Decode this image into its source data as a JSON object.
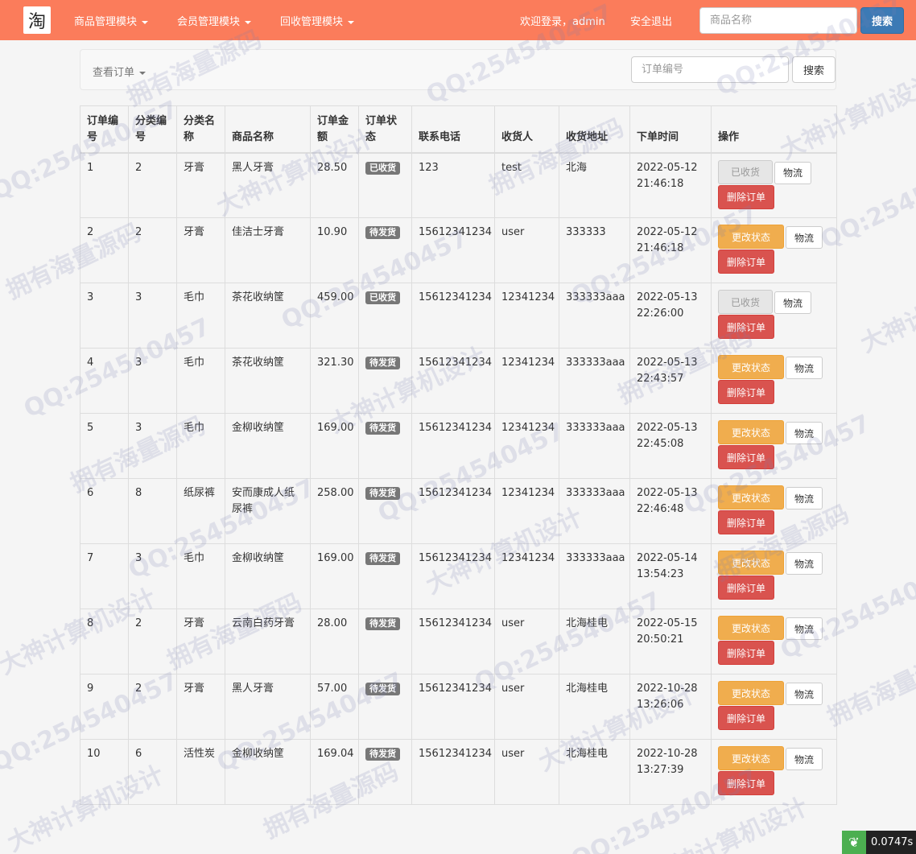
{
  "header": {
    "logo_char": "淘",
    "nav": [
      "商品管理模块",
      "会员管理模块",
      "回收管理模块"
    ],
    "welcome": "欢迎登录，admin",
    "logout": "安全退出",
    "search_placeholder": "商品名称",
    "search_button": "搜索"
  },
  "subnav": {
    "dropdown_label": "查看订单",
    "order_placeholder": "订单编号",
    "search_button": "搜索"
  },
  "table": {
    "columns": [
      "订单编号",
      "分类编号",
      "分类名称",
      "商品名称",
      "订单金额",
      "订单状态",
      "联系电话",
      "收货人",
      "收货地址",
      "下单时间",
      "操作"
    ],
    "rows": [
      {
        "id": "1",
        "cat_id": "2",
        "cat_name": "牙膏",
        "product": "黑人牙膏",
        "amount": "28.50",
        "status": "已收货",
        "phone": "123",
        "receiver": "test",
        "address": "北海",
        "date": "2022-05-12",
        "time": "21:46:18",
        "action": "已收货"
      },
      {
        "id": "2",
        "cat_id": "2",
        "cat_name": "牙膏",
        "product": "佳洁士牙膏",
        "amount": "10.90",
        "status": "待发货",
        "phone": "15612341234",
        "receiver": "user",
        "address": "333333",
        "date": "2022-05-12",
        "time": "21:46:18",
        "action": "更改状态"
      },
      {
        "id": "3",
        "cat_id": "3",
        "cat_name": "毛巾",
        "product": "茶花收纳筐",
        "amount": "459.00",
        "status": "已收货",
        "phone": "15612341234",
        "receiver": "12341234",
        "address": "333333aaa",
        "date": "2022-05-13",
        "time": "22:26:00",
        "action": "已收货"
      },
      {
        "id": "4",
        "cat_id": "3",
        "cat_name": "毛巾",
        "product": "茶花收纳筐",
        "amount": "321.30",
        "status": "待发货",
        "phone": "15612341234",
        "receiver": "12341234",
        "address": "333333aaa",
        "date": "2022-05-13",
        "time": "22:43:57",
        "action": "更改状态"
      },
      {
        "id": "5",
        "cat_id": "3",
        "cat_name": "毛巾",
        "product": "金柳收纳筐",
        "amount": "169.00",
        "status": "待发货",
        "phone": "15612341234",
        "receiver": "12341234",
        "address": "333333aaa",
        "date": "2022-05-13",
        "time": "22:45:08",
        "action": "更改状态"
      },
      {
        "id": "6",
        "cat_id": "8",
        "cat_name": "纸尿裤",
        "product": "安而康成人纸尿裤",
        "amount": "258.00",
        "status": "待发货",
        "phone": "15612341234",
        "receiver": "12341234",
        "address": "333333aaa",
        "date": "2022-05-13",
        "time": "22:46:48",
        "action": "更改状态"
      },
      {
        "id": "7",
        "cat_id": "3",
        "cat_name": "毛巾",
        "product": "金柳收纳筐",
        "amount": "169.00",
        "status": "待发货",
        "phone": "15612341234",
        "receiver": "12341234",
        "address": "333333aaa",
        "date": "2022-05-14",
        "time": "13:54:23",
        "action": "更改状态"
      },
      {
        "id": "8",
        "cat_id": "2",
        "cat_name": "牙膏",
        "product": "云南白药牙膏",
        "amount": "28.00",
        "status": "待发货",
        "phone": "15612341234",
        "receiver": "user",
        "address": "北海桂电",
        "date": "2022-05-15",
        "time": "20:50:21",
        "action": "更改状态"
      },
      {
        "id": "9",
        "cat_id": "2",
        "cat_name": "牙膏",
        "product": "黑人牙膏",
        "amount": "57.00",
        "status": "待发货",
        "phone": "15612341234",
        "receiver": "user",
        "address": "北海桂电",
        "date": "2022-10-28",
        "time": "13:26:06",
        "action": "更改状态"
      },
      {
        "id": "10",
        "cat_id": "6",
        "cat_name": "活性炭",
        "product": "金柳收纳筐",
        "amount": "169.04",
        "status": "待发货",
        "phone": "15612341234",
        "receiver": "user",
        "address": "北海桂电",
        "date": "2022-10-28",
        "time": "13:27:39",
        "action": "更改状态"
      }
    ],
    "logistics_label": "物流",
    "delete_label": "删除订单"
  },
  "timer": "0.0747s",
  "watermarks": [
    "大神计算机设计",
    "拥有海量源码",
    "QQ:254540457"
  ],
  "colors": {
    "navbar": "#fb7c5b",
    "primary": "#3c7ab5",
    "warning": "#f0ad4e",
    "danger": "#d9534f",
    "badge": "#777777"
  }
}
